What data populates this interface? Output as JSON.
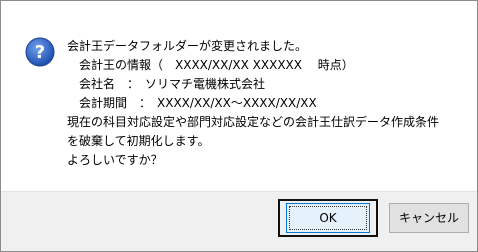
{
  "dialog": {
    "icon": "question-icon",
    "message_lines": [
      "会計王データフォルダーが変更されました。",
      "　会計王の情報（　XXXX/XX/XX XXXXXX　 時点）",
      "　会社名　：　ソリマチ電機株式会社",
      "　会計期間　：　XXXX/XX/XX～XXXX/XX/XX",
      "現在の科目対応設定や部門対応設定などの会計王仕訳データ作成条件",
      "を破棄して初期化します。",
      "よろしいですか？"
    ],
    "buttons": {
      "ok_label": "OK",
      "cancel_label": "キャンセル"
    }
  },
  "colors": {
    "icon_blue": "#2b63c5",
    "focus_border": "#0078d7",
    "footer_bg": "#f0f0f0"
  }
}
